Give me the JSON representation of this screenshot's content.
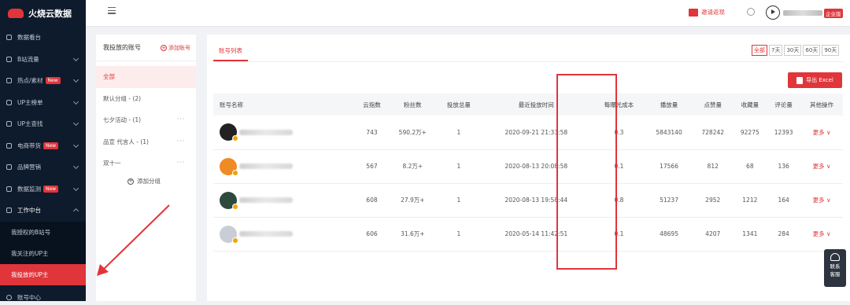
{
  "app": {
    "title": "火烧云数据"
  },
  "sidebar": {
    "items": [
      {
        "label": "数据看台",
        "icon": "gear-icon",
        "new": false,
        "chevron": false
      },
      {
        "label": "B站流量",
        "icon": "traffic-icon",
        "new": false,
        "chevron": true
      },
      {
        "label": "热点/素材",
        "icon": "fire-icon",
        "new": true,
        "chevron": true
      },
      {
        "label": "UP主榜单",
        "icon": "chart-icon",
        "new": false,
        "chevron": true
      },
      {
        "label": "UP主查找",
        "icon": "search-icon",
        "new": false,
        "chevron": true
      },
      {
        "label": "电商带货",
        "icon": "cart-icon",
        "new": true,
        "chevron": true
      },
      {
        "label": "品牌营销",
        "icon": "brand-icon",
        "new": false,
        "chevron": true
      },
      {
        "label": "数据监测",
        "icon": "monitor-icon",
        "new": true,
        "chevron": true
      },
      {
        "label": "工作中台",
        "icon": "grid-icon",
        "new": false,
        "chevron": true,
        "open": true
      }
    ],
    "new_label": "New",
    "sub_items": [
      "我授权的B站号",
      "我关注的UP主",
      "我投放的UP主"
    ],
    "active_sub": "我投放的UP主",
    "bottom_item": "账号中心"
  },
  "topbar": {
    "invite_label": "邀请返现",
    "corp_badge": "企业版"
  },
  "left_panel": {
    "title": "我投放的账号",
    "add_account": "添加账号",
    "groups": [
      {
        "label": "全部",
        "active": true,
        "more": ""
      },
      {
        "label": "默认分组 - (2)",
        "active": false,
        "more": ""
      },
      {
        "label": "七夕活动 - (1)",
        "active": false,
        "more": "···"
      },
      {
        "label": "品宣 代言人 - (1)",
        "active": false,
        "more": "···"
      },
      {
        "label": "双十一",
        "active": false,
        "more": "···"
      }
    ],
    "add_group": "添加分组"
  },
  "main": {
    "tab": "账号列表",
    "ranges": [
      "全部",
      "7天",
      "30天",
      "60天",
      "90天"
    ],
    "active_range": "全部",
    "export_label": "导出 Excel",
    "table": {
      "headers": [
        "账号名称",
        "云指数",
        "粉丝数",
        "投放总量",
        "最近投放时间",
        "每曝光成本",
        "播放量",
        "点赞量",
        "收藏量",
        "评论量",
        "其他操作"
      ],
      "rows": [
        {
          "avatar_color": "#222222",
          "cloud_index": "743",
          "fans": "590.2万+",
          "total": "1",
          "last_time": "2020-09-21 21:33:58",
          "cost": "0.3",
          "plays": "5843140",
          "likes": "728242",
          "favorites": "92275",
          "comments": "12393",
          "action": "更多 ∨"
        },
        {
          "avatar_color": "#f08a24",
          "cloud_index": "567",
          "fans": "8.2万+",
          "total": "1",
          "last_time": "2020-08-13 20:08:58",
          "cost": "0.1",
          "plays": "17566",
          "likes": "812",
          "favorites": "68",
          "comments": "136",
          "action": "更多 ∨"
        },
        {
          "avatar_color": "#2e4a3c",
          "cloud_index": "608",
          "fans": "27.9万+",
          "total": "1",
          "last_time": "2020-08-13 19:58:44",
          "cost": "0.8",
          "plays": "51237",
          "likes": "2952",
          "favorites": "1212",
          "comments": "164",
          "action": "更多 ∨"
        },
        {
          "avatar_color": "#c9ced6",
          "cloud_index": "606",
          "fans": "31.6万+",
          "total": "1",
          "last_time": "2020-05-14 11:42:51",
          "cost": "0.1",
          "plays": "48695",
          "likes": "4207",
          "favorites": "1341",
          "comments": "284",
          "action": "更多 ∨"
        }
      ]
    }
  },
  "service": {
    "line1": "联系",
    "line2": "客服"
  },
  "colors": {
    "accent": "#e0353b",
    "sidebar_bg": "#0e1b2c"
  }
}
